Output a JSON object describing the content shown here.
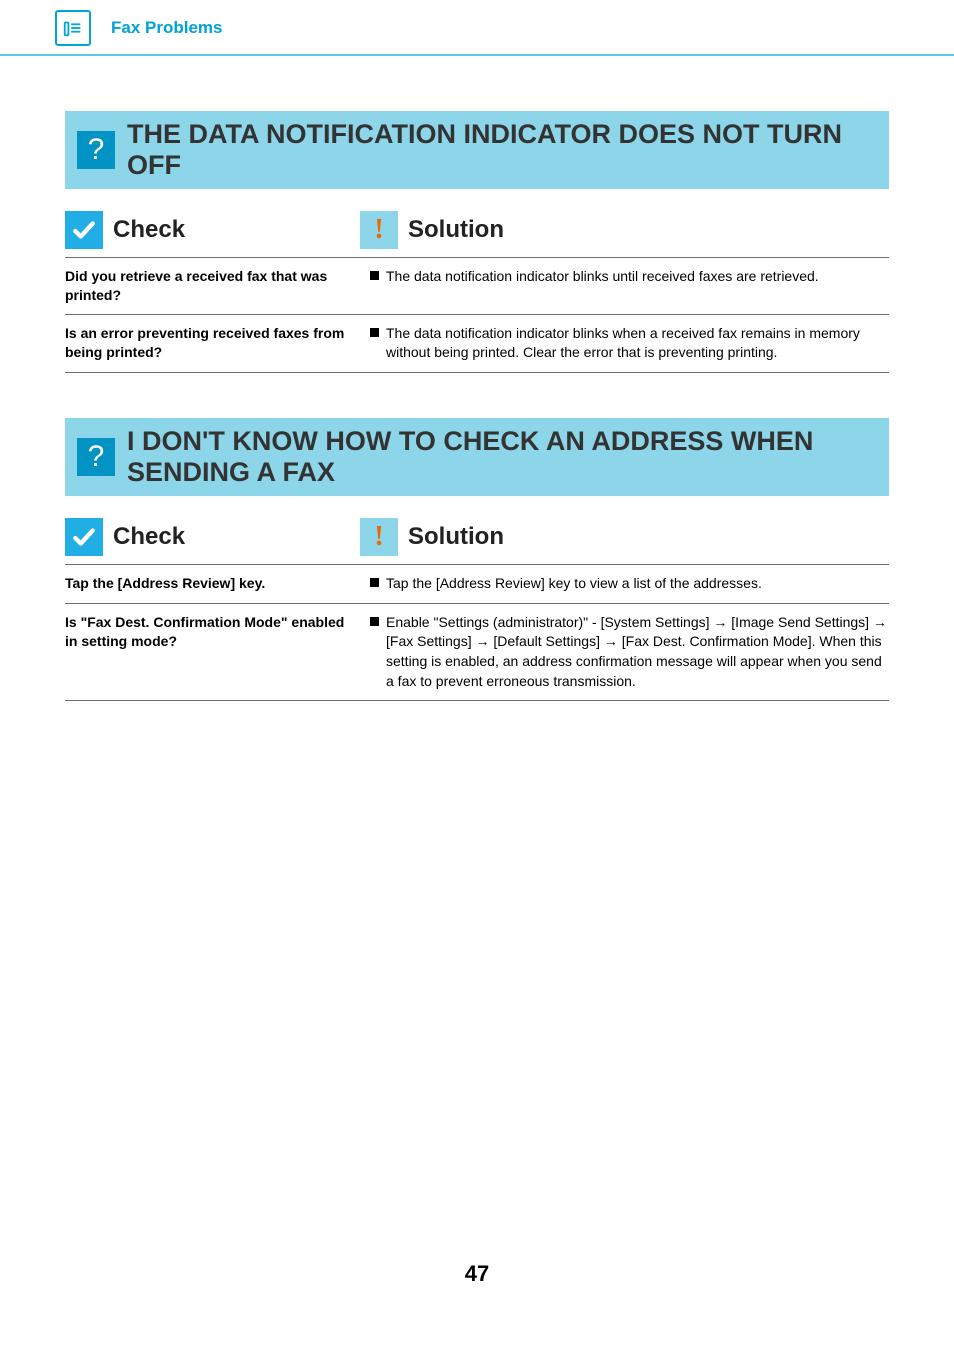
{
  "header": {
    "breadcrumb": "Fax Problems"
  },
  "labels": {
    "check": "Check",
    "solution": "Solution"
  },
  "problems": [
    {
      "title": "THE DATA NOTIFICATION INDICATOR DOES NOT TURN OFF",
      "rows": [
        {
          "check": "Did you retrieve a received fax that was printed?",
          "solution": "The data notification indicator blinks until received faxes are retrieved."
        },
        {
          "check": "Is an error preventing received faxes from being printed?",
          "solution": "The data notification indicator blinks when a received fax remains in memory without being printed. Clear the error that is preventing printing."
        }
      ]
    },
    {
      "title": "I DON'T KNOW HOW TO CHECK AN ADDRESS WHEN SENDING A FAX",
      "rows": [
        {
          "check": "Tap the [Address Review] key.",
          "solution": "Tap the [Address Review] key to view a list of the addresses."
        },
        {
          "check": "Is \"Fax Dest. Confirmation Mode\" enabled in setting mode?",
          "solution": "Enable \"Settings (administrator)\" - [System Settings] → [Image Send Settings] → [Fax Settings] → [Default Settings] → [Fax Dest. Confirmation Mode]. When this setting is enabled, an address confirmation message will appear when you send a fax to prevent erroneous transmission."
        }
      ]
    }
  ],
  "page_number": "47"
}
